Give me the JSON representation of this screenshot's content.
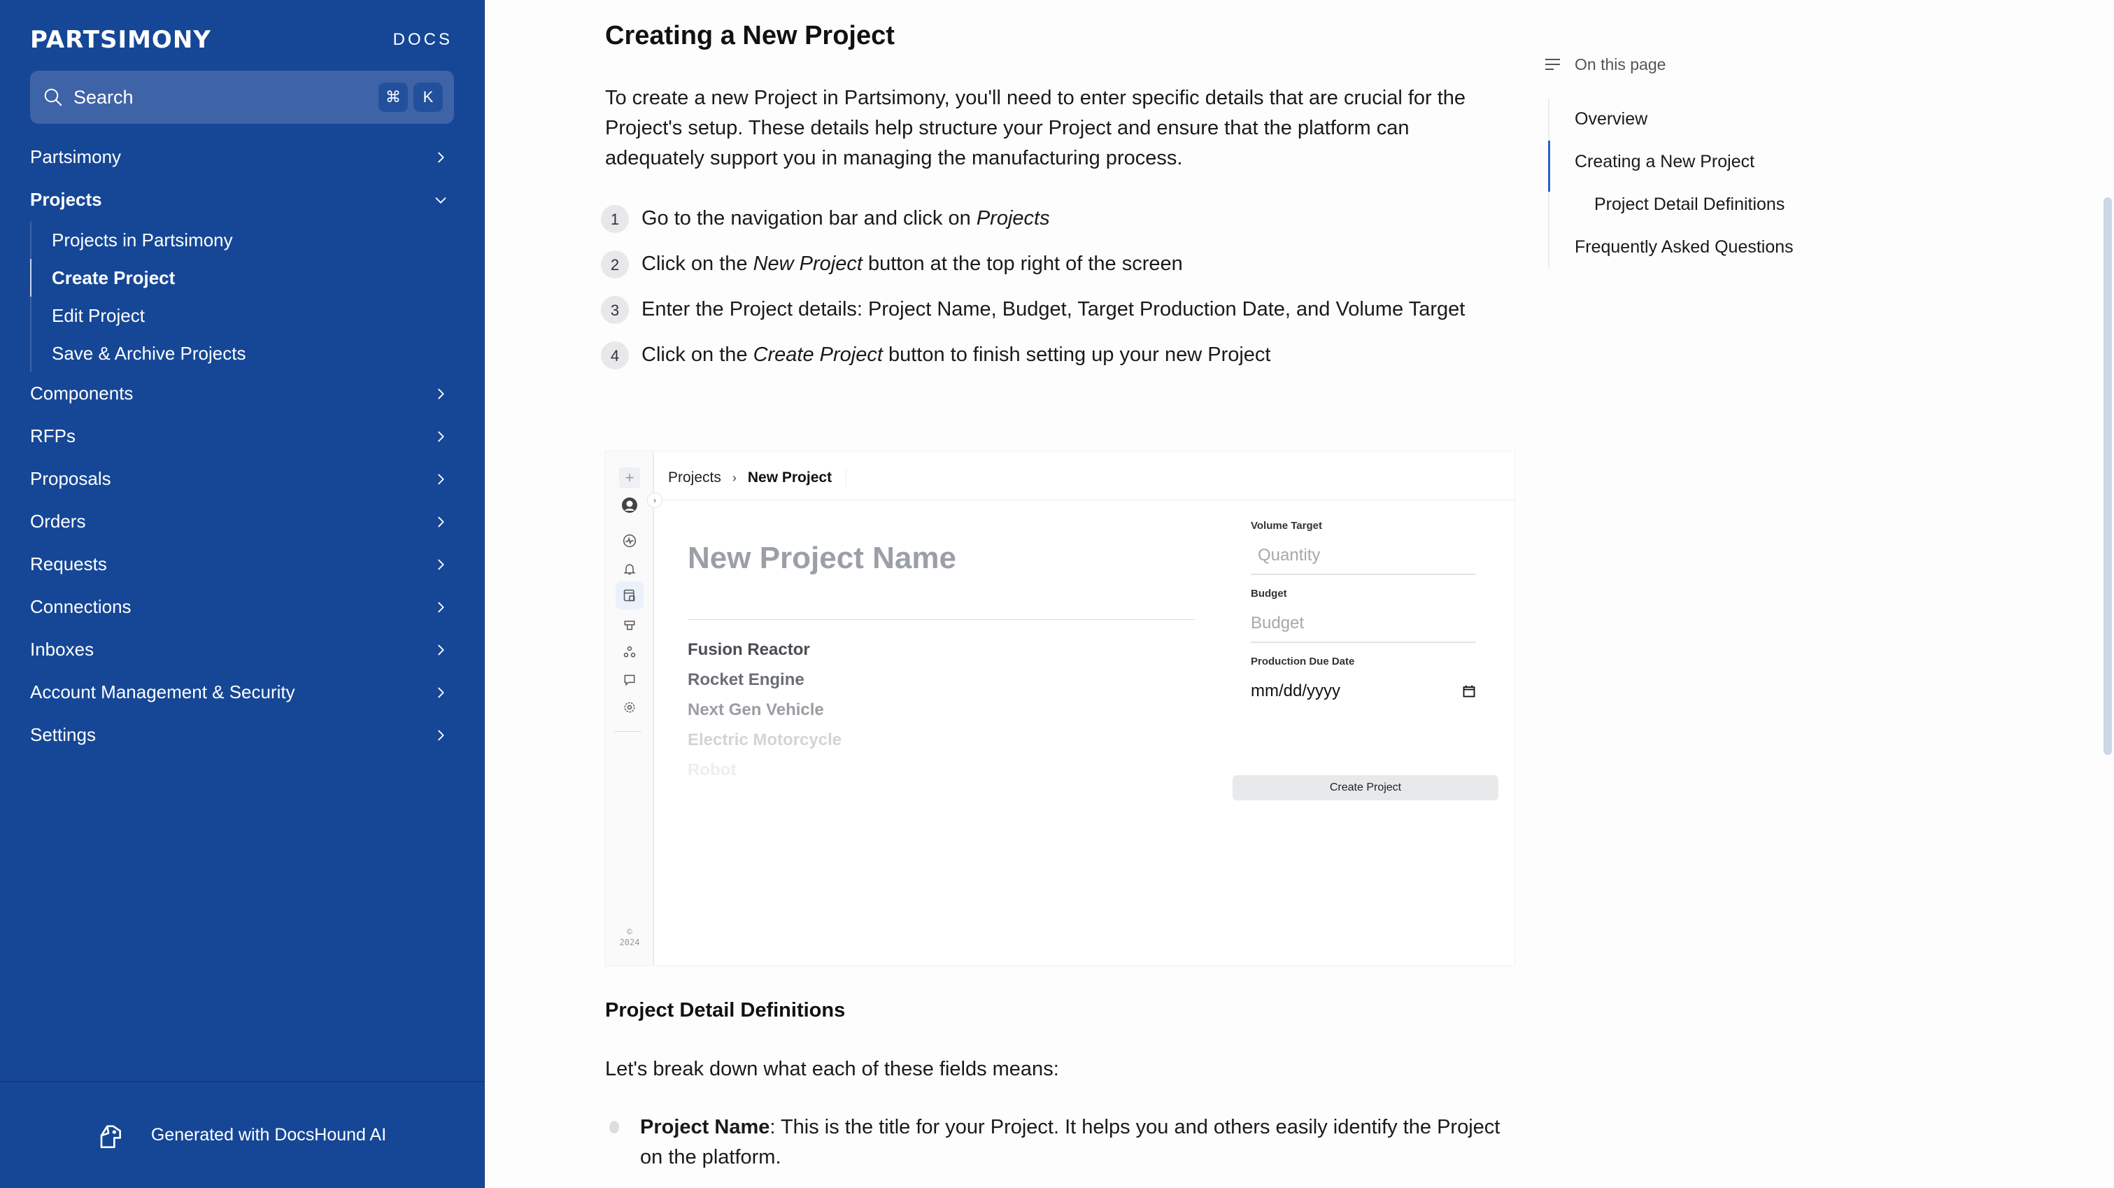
{
  "sidebar": {
    "logo": "PARTSIMONY",
    "docs_label": "DOCS",
    "search": {
      "label": "Search",
      "shortcut_keys": [
        "⌘",
        "K"
      ]
    },
    "items": [
      {
        "label": "Partsimony",
        "expanded": false
      },
      {
        "label": "Projects",
        "expanded": true,
        "children": [
          {
            "label": "Projects in Partsimony",
            "active": false
          },
          {
            "label": "Create Project",
            "active": true
          },
          {
            "label": "Edit Project",
            "active": false
          },
          {
            "label": "Save & Archive Projects",
            "active": false
          }
        ]
      },
      {
        "label": "Components",
        "expanded": false
      },
      {
        "label": "RFPs",
        "expanded": false
      },
      {
        "label": "Proposals",
        "expanded": false
      },
      {
        "label": "Orders",
        "expanded": false
      },
      {
        "label": "Requests",
        "expanded": false
      },
      {
        "label": "Connections",
        "expanded": false
      },
      {
        "label": "Inboxes",
        "expanded": false
      },
      {
        "label": "Account Management & Security",
        "expanded": false
      },
      {
        "label": "Settings",
        "expanded": false
      }
    ],
    "footer": "Generated with DocsHound AI"
  },
  "main": {
    "title": "Creating a New Project",
    "intro": "To create a new Project in Partsimony, you'll need to enter specific details that are crucial for the Project's setup. These details help structure your Project and ensure that the platform can adequately support you in managing the manufacturing process.",
    "steps": [
      {
        "num": "1",
        "before": "Go to the navigation bar and click on ",
        "em": "Projects",
        "after": ""
      },
      {
        "num": "2",
        "before": "Click on the ",
        "em": "New Project",
        "after": " button at the top right of the screen"
      },
      {
        "num": "3",
        "before": "Enter the Project details: Project Name, Budget, Target Production Date, and Volume Target",
        "em": "",
        "after": ""
      },
      {
        "num": "4",
        "before": "Click on the ",
        "em": "Create Project",
        "after": " button to finish setting up your new Project"
      }
    ],
    "screenshot": {
      "breadcrumb": [
        "Projects",
        "New Project"
      ],
      "name_placeholder": "New Project Name",
      "suggestions": [
        "Fusion Reactor",
        "Rocket Engine",
        "Next Gen Vehicle",
        "Electric Motorcycle",
        "Robot"
      ],
      "fields": {
        "volume_label": "Volume Target",
        "volume_placeholder": "Quantity",
        "budget_label": "Budget",
        "budget_placeholder": "Budget",
        "date_label": "Production Due Date",
        "date_placeholder": "mm/dd/yyyy"
      },
      "create_button": "Create Project",
      "copyright_symbol": "©",
      "copyright_year": "2024"
    },
    "section2_title": "Project Detail Definitions",
    "section2_intro": "Let's break down what each of these fields means:",
    "definitions": [
      {
        "term": "Project Name",
        "text": ": This is the title for your Project. It helps you and others easily identify the Project on the platform."
      }
    ]
  },
  "toc": {
    "heading": "On this page",
    "items": [
      {
        "label": "Overview",
        "indent": false,
        "active": false
      },
      {
        "label": "Creating a New Project",
        "indent": false,
        "active": true
      },
      {
        "label": "Project Detail Definitions",
        "indent": true,
        "active": false
      },
      {
        "label": "Frequently Asked Questions",
        "indent": false,
        "active": false
      }
    ]
  },
  "colors": {
    "sidebar_bg": "#164796",
    "search_bg": "#3f63a7",
    "toc_active": "#2563c4",
    "scrollbar": "#c9d7e7"
  }
}
